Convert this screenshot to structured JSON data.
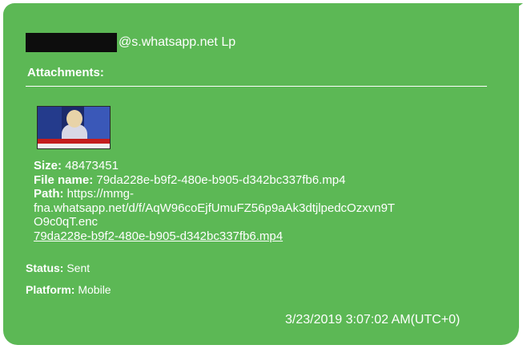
{
  "sender": {
    "domain_text": "@s.whatsapp.net Lp"
  },
  "attachments_label": "Attachments:",
  "attachment": {
    "size_label": "Size:",
    "size_value": "48473451",
    "file_name_label": "File name:",
    "file_name_value": "79da228e-b9f2-480e-b905-d342bc337fb6.mp4",
    "path_label": "Path:",
    "path_line1": "https://mmg-",
    "path_line2": "fna.whatsapp.net/d/f/AqW96coEjfUmuFZ56p9aAk3dtjlpedcOzxvn9T",
    "path_line3": "O9c0qT.enc",
    "path_link": "79da228e-b9f2-480e-b905-d342bc337fb6.mp4"
  },
  "status": {
    "label": "Status:",
    "value": "Sent"
  },
  "platform": {
    "label": "Platform:",
    "value": "Mobile"
  },
  "timestamp": "3/23/2019 3:07:02 AM(UTC+0)",
  "colors": {
    "bubble": "#5cb855",
    "text": "#ffffff",
    "redaction": "#0d0d0d"
  }
}
